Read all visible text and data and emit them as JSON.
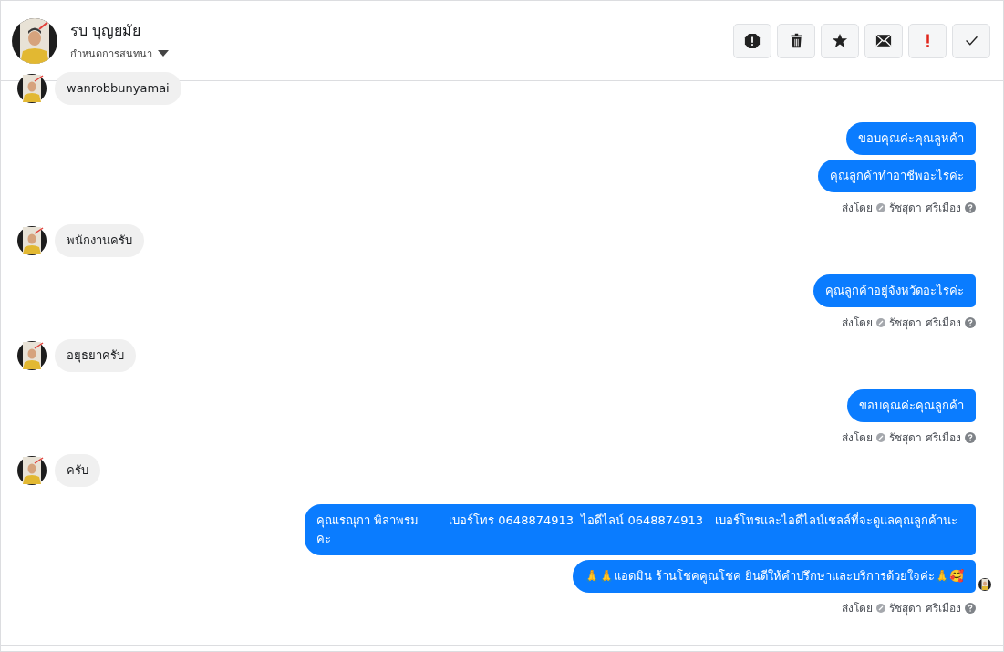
{
  "header": {
    "name": "รบ บุญยมัย",
    "subtitle": "กำหนดการสนทนา"
  },
  "actions": [
    {
      "kind": "alert"
    },
    {
      "kind": "trash"
    },
    {
      "kind": "star"
    },
    {
      "kind": "mail"
    },
    {
      "kind": "important"
    },
    {
      "kind": "check"
    }
  ],
  "groups": [
    {
      "kind": "in",
      "messages": [
        {
          "text": "wanrobbunyamai",
          "seen": false
        }
      ]
    },
    {
      "kind": "out",
      "messages": [
        {
          "text": "ขอบคุณค่ะคุณลูหค้า",
          "seen": false
        },
        {
          "text": "คุณลูกค้าทำอาชีพอะไรค่ะ",
          "seen": false
        }
      ],
      "sent_by": {
        "label": "ส่งโดย",
        "name": "รัชสุดา ศรีเมือง"
      }
    },
    {
      "kind": "in",
      "messages": [
        {
          "text": "พนักงานครับ",
          "seen": false
        }
      ]
    },
    {
      "kind": "out",
      "messages": [
        {
          "text": "คุณลูกค้าอยู่จังหวัดอะไรค่ะ",
          "seen": false
        }
      ],
      "sent_by": {
        "label": "ส่งโดย",
        "name": "รัชสุดา ศรีเมือง"
      }
    },
    {
      "kind": "in",
      "messages": [
        {
          "text": "อยุธยาครับ",
          "seen": false
        }
      ]
    },
    {
      "kind": "out",
      "messages": [
        {
          "text": "ขอบคุณค่ะคุณลูกค้า",
          "seen": false
        }
      ],
      "sent_by": {
        "label": "ส่งโดย",
        "name": "รัชสุดา ศรีเมือง"
      }
    },
    {
      "kind": "in",
      "messages": [
        {
          "text": "ครับ",
          "seen": false
        }
      ]
    },
    {
      "kind": "out",
      "messages": [
        {
          "text": "คุณเรณุกา พิลาพรม        เบอร์โทร 0648874913  ไอดีไลน์ 0648874913   เบอร์โทรและไอดีไลน์เชลล์ที่จะดูแลคุณลูกค้านะคะ",
          "seen": false
        },
        {
          "text": "🙏🙏แอดมิน ร้านโชคคูณโชค ยินดีให้คำปรึกษาและบริการด้วยใจค่ะ🙏🥰",
          "seen": true
        }
      ],
      "sent_by": {
        "label": "ส่งโดย",
        "name": "รัชสุดา ศรีเมือง"
      }
    }
  ]
}
